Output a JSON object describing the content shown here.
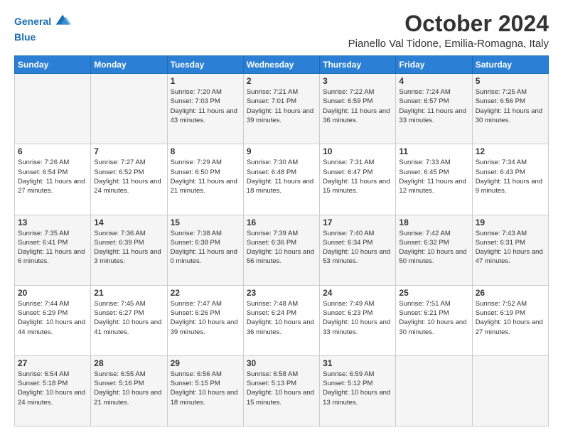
{
  "header": {
    "logo_line1": "General",
    "logo_line2": "Blue",
    "month_title": "October 2024",
    "location": "Pianello Val Tidone, Emilia-Romagna, Italy"
  },
  "weekdays": [
    "Sunday",
    "Monday",
    "Tuesday",
    "Wednesday",
    "Thursday",
    "Friday",
    "Saturday"
  ],
  "weeks": [
    [
      {
        "day": "",
        "sunrise": "",
        "sunset": "",
        "daylight": ""
      },
      {
        "day": "",
        "sunrise": "",
        "sunset": "",
        "daylight": ""
      },
      {
        "day": "1",
        "sunrise": "Sunrise: 7:20 AM",
        "sunset": "Sunset: 7:03 PM",
        "daylight": "Daylight: 11 hours and 43 minutes."
      },
      {
        "day": "2",
        "sunrise": "Sunrise: 7:21 AM",
        "sunset": "Sunset: 7:01 PM",
        "daylight": "Daylight: 11 hours and 39 minutes."
      },
      {
        "day": "3",
        "sunrise": "Sunrise: 7:22 AM",
        "sunset": "Sunset: 6:59 PM",
        "daylight": "Daylight: 11 hours and 36 minutes."
      },
      {
        "day": "4",
        "sunrise": "Sunrise: 7:24 AM",
        "sunset": "Sunset: 6:57 PM",
        "daylight": "Daylight: 11 hours and 33 minutes."
      },
      {
        "day": "5",
        "sunrise": "Sunrise: 7:25 AM",
        "sunset": "Sunset: 6:56 PM",
        "daylight": "Daylight: 11 hours and 30 minutes."
      }
    ],
    [
      {
        "day": "6",
        "sunrise": "Sunrise: 7:26 AM",
        "sunset": "Sunset: 6:54 PM",
        "daylight": "Daylight: 11 hours and 27 minutes."
      },
      {
        "day": "7",
        "sunrise": "Sunrise: 7:27 AM",
        "sunset": "Sunset: 6:52 PM",
        "daylight": "Daylight: 11 hours and 24 minutes."
      },
      {
        "day": "8",
        "sunrise": "Sunrise: 7:29 AM",
        "sunset": "Sunset: 6:50 PM",
        "daylight": "Daylight: 11 hours and 21 minutes."
      },
      {
        "day": "9",
        "sunrise": "Sunrise: 7:30 AM",
        "sunset": "Sunset: 6:48 PM",
        "daylight": "Daylight: 11 hours and 18 minutes."
      },
      {
        "day": "10",
        "sunrise": "Sunrise: 7:31 AM",
        "sunset": "Sunset: 6:47 PM",
        "daylight": "Daylight: 11 hours and 15 minutes."
      },
      {
        "day": "11",
        "sunrise": "Sunrise: 7:33 AM",
        "sunset": "Sunset: 6:45 PM",
        "daylight": "Daylight: 11 hours and 12 minutes."
      },
      {
        "day": "12",
        "sunrise": "Sunrise: 7:34 AM",
        "sunset": "Sunset: 6:43 PM",
        "daylight": "Daylight: 11 hours and 9 minutes."
      }
    ],
    [
      {
        "day": "13",
        "sunrise": "Sunrise: 7:35 AM",
        "sunset": "Sunset: 6:41 PM",
        "daylight": "Daylight: 11 hours and 6 minutes."
      },
      {
        "day": "14",
        "sunrise": "Sunrise: 7:36 AM",
        "sunset": "Sunset: 6:39 PM",
        "daylight": "Daylight: 11 hours and 3 minutes."
      },
      {
        "day": "15",
        "sunrise": "Sunrise: 7:38 AM",
        "sunset": "Sunset: 6:38 PM",
        "daylight": "Daylight: 11 hours and 0 minutes."
      },
      {
        "day": "16",
        "sunrise": "Sunrise: 7:39 AM",
        "sunset": "Sunset: 6:36 PM",
        "daylight": "Daylight: 10 hours and 56 minutes."
      },
      {
        "day": "17",
        "sunrise": "Sunrise: 7:40 AM",
        "sunset": "Sunset: 6:34 PM",
        "daylight": "Daylight: 10 hours and 53 minutes."
      },
      {
        "day": "18",
        "sunrise": "Sunrise: 7:42 AM",
        "sunset": "Sunset: 6:32 PM",
        "daylight": "Daylight: 10 hours and 50 minutes."
      },
      {
        "day": "19",
        "sunrise": "Sunrise: 7:43 AM",
        "sunset": "Sunset: 6:31 PM",
        "daylight": "Daylight: 10 hours and 47 minutes."
      }
    ],
    [
      {
        "day": "20",
        "sunrise": "Sunrise: 7:44 AM",
        "sunset": "Sunset: 6:29 PM",
        "daylight": "Daylight: 10 hours and 44 minutes."
      },
      {
        "day": "21",
        "sunrise": "Sunrise: 7:45 AM",
        "sunset": "Sunset: 6:27 PM",
        "daylight": "Daylight: 10 hours and 41 minutes."
      },
      {
        "day": "22",
        "sunrise": "Sunrise: 7:47 AM",
        "sunset": "Sunset: 6:26 PM",
        "daylight": "Daylight: 10 hours and 39 minutes."
      },
      {
        "day": "23",
        "sunrise": "Sunrise: 7:48 AM",
        "sunset": "Sunset: 6:24 PM",
        "daylight": "Daylight: 10 hours and 36 minutes."
      },
      {
        "day": "24",
        "sunrise": "Sunrise: 7:49 AM",
        "sunset": "Sunset: 6:23 PM",
        "daylight": "Daylight: 10 hours and 33 minutes."
      },
      {
        "day": "25",
        "sunrise": "Sunrise: 7:51 AM",
        "sunset": "Sunset: 6:21 PM",
        "daylight": "Daylight: 10 hours and 30 minutes."
      },
      {
        "day": "26",
        "sunrise": "Sunrise: 7:52 AM",
        "sunset": "Sunset: 6:19 PM",
        "daylight": "Daylight: 10 hours and 27 minutes."
      }
    ],
    [
      {
        "day": "27",
        "sunrise": "Sunrise: 6:54 AM",
        "sunset": "Sunset: 5:18 PM",
        "daylight": "Daylight: 10 hours and 24 minutes."
      },
      {
        "day": "28",
        "sunrise": "Sunrise: 6:55 AM",
        "sunset": "Sunset: 5:16 PM",
        "daylight": "Daylight: 10 hours and 21 minutes."
      },
      {
        "day": "29",
        "sunrise": "Sunrise: 6:56 AM",
        "sunset": "Sunset: 5:15 PM",
        "daylight": "Daylight: 10 hours and 18 minutes."
      },
      {
        "day": "30",
        "sunrise": "Sunrise: 6:58 AM",
        "sunset": "Sunset: 5:13 PM",
        "daylight": "Daylight: 10 hours and 15 minutes."
      },
      {
        "day": "31",
        "sunrise": "Sunrise: 6:59 AM",
        "sunset": "Sunset: 5:12 PM",
        "daylight": "Daylight: 10 hours and 13 minutes."
      },
      {
        "day": "",
        "sunrise": "",
        "sunset": "",
        "daylight": ""
      },
      {
        "day": "",
        "sunrise": "",
        "sunset": "",
        "daylight": ""
      }
    ]
  ]
}
